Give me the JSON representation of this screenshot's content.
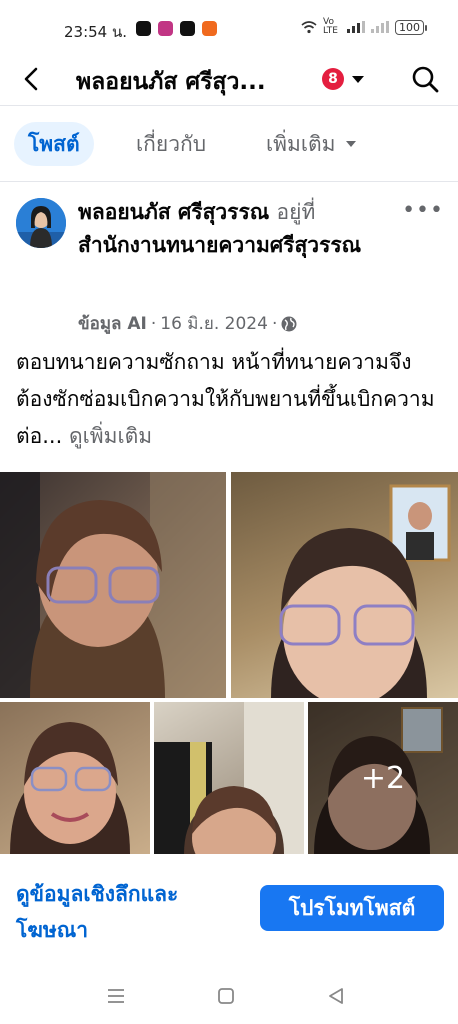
{
  "status_bar": {
    "time": "23:54 น.",
    "network_label": "Vo LTE",
    "battery": "100"
  },
  "header": {
    "title": "พลอยนภัส ศรีสุว...",
    "notification_count": "8"
  },
  "tabs": [
    {
      "label": "โพสต์"
    },
    {
      "label": "เกี่ยวกับ"
    },
    {
      "label": "เพิ่มเติม"
    }
  ],
  "post": {
    "author": "พลอยนภัส ศรีสุวรรณ",
    "at_word": "อยู่ที่",
    "location": "สำนักงานทนายความศรีสุวรรณ",
    "meta_source": "ข้อมูล AI",
    "meta_date": "16 มิ.ย. 2024",
    "text": "ตอบทนายความซักถาม หน้าที่ทนายความจึงต้องซักซ่อมเบิกความให้กับพยานที่ขึ้นเบิกความต่อ...",
    "see_more": "ดูเพิ่มเติม",
    "extra_photos": "+2"
  },
  "actions": {
    "insights": "ดูข้อมูลเชิงลึกและโฆษณา",
    "promote": "โปรโมทโพสต์"
  },
  "colors": {
    "accent": "#1877f2",
    "link": "#0064d1",
    "badge": "#e41e3f",
    "tab_active_bg": "#e7f3ff"
  }
}
